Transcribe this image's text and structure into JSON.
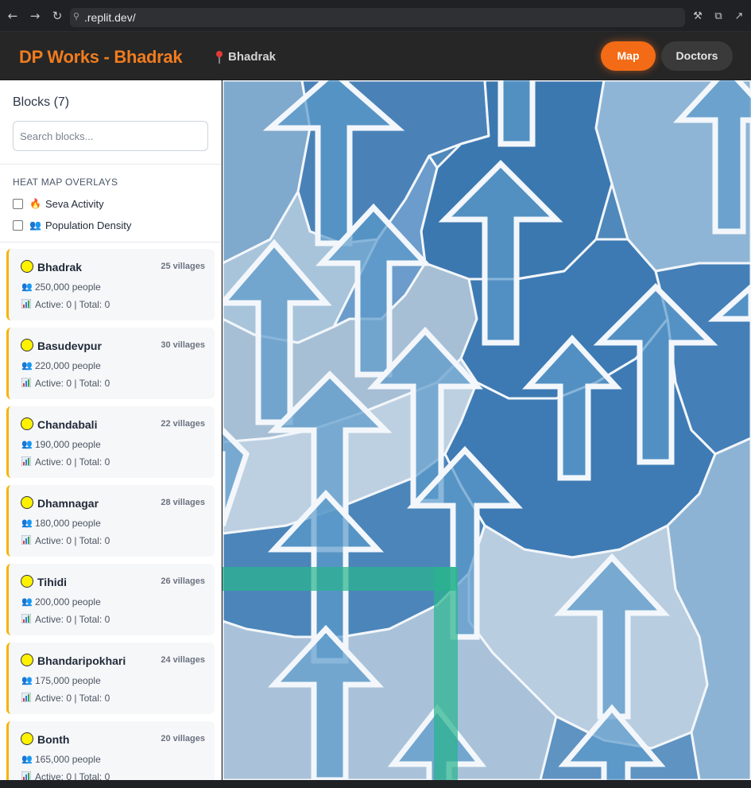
{
  "browser": {
    "url": ".replit.dev/"
  },
  "header": {
    "title": "DP Works - Bhadrak",
    "location": "Bhadrak",
    "nav": {
      "map_label": "Map",
      "doctors_label": "Doctors"
    }
  },
  "sidebar": {
    "blocks_title": "Blocks (7)",
    "search_placeholder": "Search blocks...",
    "overlays_title": "HEAT MAP OVERLAYS",
    "overlays": [
      {
        "label": "Seva Activity",
        "icon": "fire-icon",
        "checked": false
      },
      {
        "label": "Population Density",
        "icon": "people-icon",
        "checked": false
      }
    ],
    "blocks": [
      {
        "name": "Bhadrak",
        "villages": "25 villages",
        "people": "250,000 people",
        "stats": "Active: 0 | Total: 0"
      },
      {
        "name": "Basudevpur",
        "villages": "30 villages",
        "people": "220,000 people",
        "stats": "Active: 0 | Total: 0"
      },
      {
        "name": "Chandabali",
        "villages": "22 villages",
        "people": "190,000 people",
        "stats": "Active: 0 | Total: 0"
      },
      {
        "name": "Dhamnagar",
        "villages": "28 villages",
        "people": "180,000 people",
        "stats": "Active: 0 | Total: 0"
      },
      {
        "name": "Tihidi",
        "villages": "26 villages",
        "people": "200,000 people",
        "stats": "Active: 0 | Total: 0"
      },
      {
        "name": "Bhandaripokhari",
        "villages": "24 villages",
        "people": "175,000 people",
        "stats": "Active: 0 | Total: 0"
      },
      {
        "name": "Bonth",
        "villages": "20 villages",
        "people": "165,000 people",
        "stats": "Active: 0 | Total: 0"
      }
    ]
  },
  "colors": {
    "brand": "#f07c1e",
    "active_nav": "#f36b16",
    "block_marker": "#fff200",
    "card_accent": "#f5b400",
    "map_dark_blue": "#3d7db5",
    "map_light_blue": "#a9c6dd",
    "route_green": "#2ab48e"
  }
}
